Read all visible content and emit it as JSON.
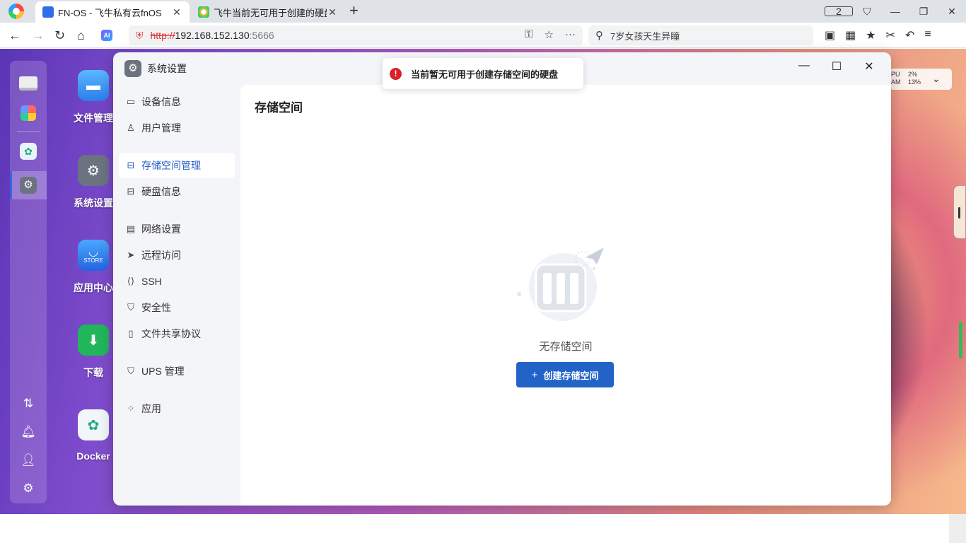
{
  "browser": {
    "tabs": [
      {
        "title": "FN-OS - 飞牛私有云fnOS",
        "active": true
      },
      {
        "title": "飞牛当前无可用于创建的硬盘",
        "active": false
      }
    ],
    "tab_count": "2",
    "url": {
      "scheme": "http://",
      "host": "192.168.152.130",
      "port": ":5666"
    },
    "search_text": "7岁女孩天生异瞳",
    "ai_label": "AI"
  },
  "desktop": {
    "icons": [
      {
        "label": "文件管理"
      },
      {
        "label": "系统设置"
      },
      {
        "label": "应用中心",
        "sublabel": "STORE"
      },
      {
        "label": "下载"
      },
      {
        "label": "Docker"
      }
    ],
    "sysmon": {
      "cpu_label": "PU",
      "ram_label": "AM",
      "cpu_value": "2%",
      "ram_value": "13%"
    }
  },
  "window": {
    "title": "系统设置",
    "nav": [
      {
        "label": "设备信息",
        "icon": "device-icon"
      },
      {
        "label": "用户管理",
        "icon": "user-icon"
      },
      {
        "label": "存储空间管理",
        "icon": "storage-icon",
        "active": true
      },
      {
        "label": "硬盘信息",
        "icon": "disk-icon"
      },
      {
        "label": "网络设置",
        "icon": "network-icon"
      },
      {
        "label": "远程访问",
        "icon": "send-icon"
      },
      {
        "label": "SSH",
        "icon": "code-icon"
      },
      {
        "label": "安全性",
        "icon": "shield-icon"
      },
      {
        "label": "文件共享协议",
        "icon": "file-icon"
      },
      {
        "label": "UPS 管理",
        "icon": "ups-icon"
      },
      {
        "label": "应用",
        "icon": "apps-icon"
      }
    ],
    "content": {
      "title": "存储空间",
      "empty_text": "无存储空间",
      "create_button": "创建存储空间"
    }
  },
  "toast": {
    "message": "当前暂无可用于创建存储空间的硬盘",
    "type": "error"
  },
  "colors": {
    "accent": "#2263c8",
    "error": "#d9222a"
  }
}
